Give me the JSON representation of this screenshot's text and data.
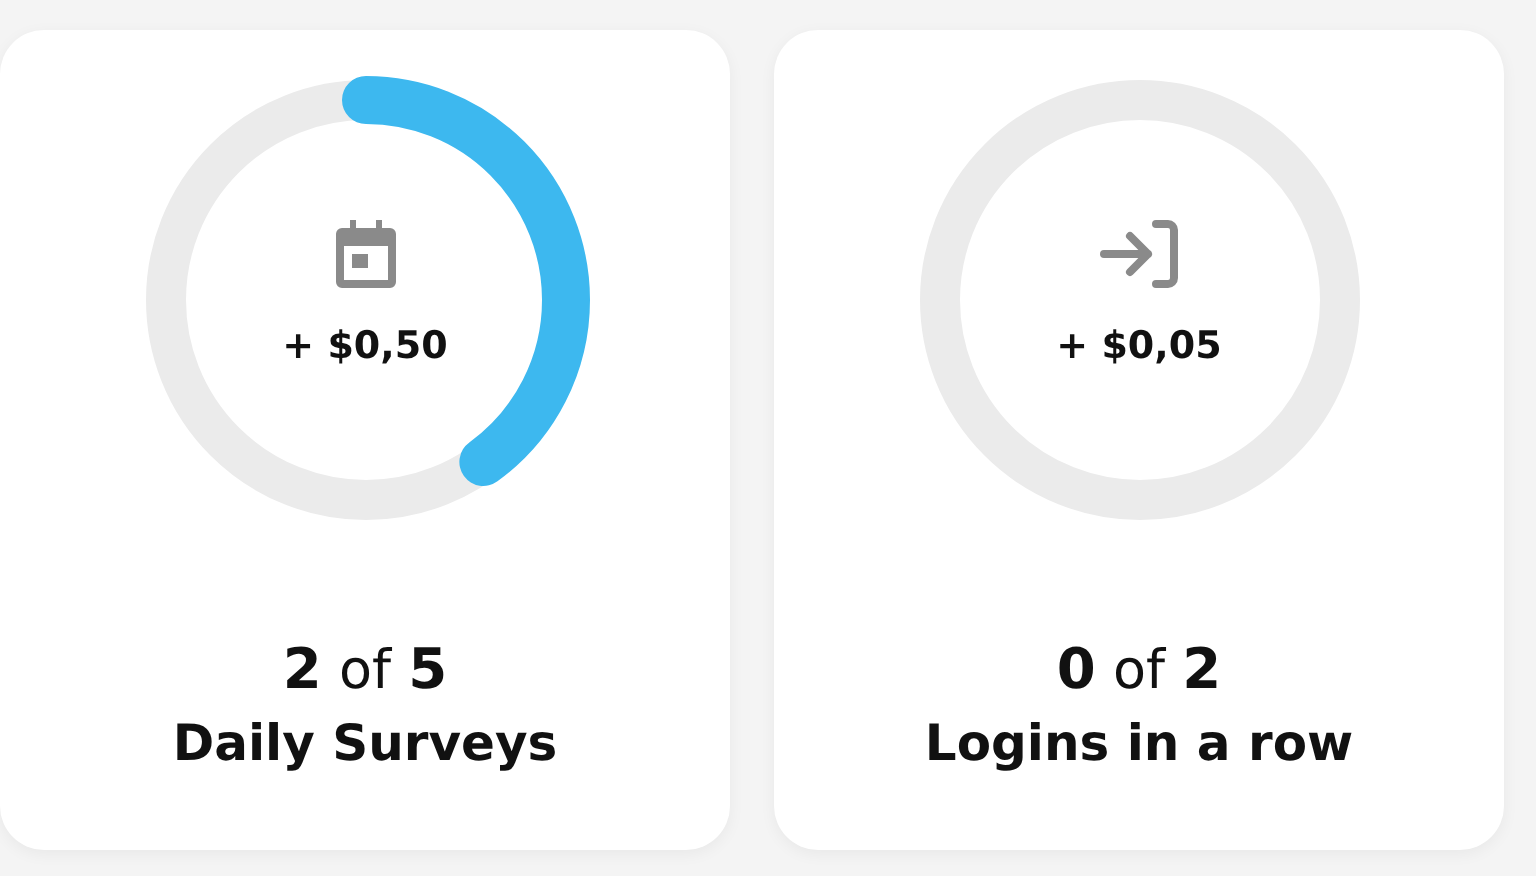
{
  "cards": [
    {
      "kind": "calendar",
      "reward": "+ $0,50",
      "count": "**2** of **5**",
      "title": "Daily Surveys"
    },
    {
      "kind": "login",
      "reward": "+ $0,05",
      "count": "**0** of **2**",
      "title": "Logins in a row"
    }
  ]
}
